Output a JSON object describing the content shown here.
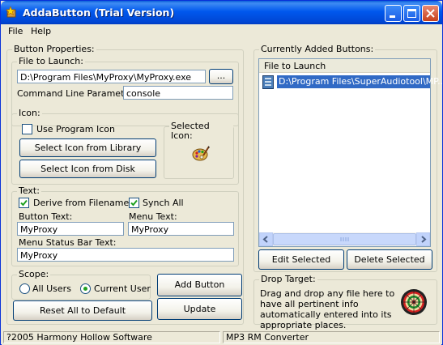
{
  "window": {
    "title": "AddaButton (Trial Version)"
  },
  "menu": {
    "file": "File",
    "help": "Help"
  },
  "button_properties": {
    "label": "Button Properties:",
    "file_to_launch": {
      "label": "File to Launch:",
      "value": "D:\\Program Files\\MyProxy\\MyProxy.exe",
      "browse": "..."
    },
    "command_line": {
      "label": "Command Line Parameters:",
      "value": "console"
    }
  },
  "icon": {
    "label": "Icon:",
    "use_program_icon": "Use Program Icon",
    "use_program_icon_checked": false,
    "selected_icon_label": "Selected Icon:",
    "select_library": "Select Icon from Library",
    "select_disk": "Select Icon from Disk"
  },
  "text": {
    "label": "Text:",
    "derive_from_filename": "Derive from Filename",
    "derive_checked": true,
    "synch_all": "Synch All",
    "synch_checked": true,
    "button_text_label": "Button Text:",
    "button_text_value": "MyProxy",
    "menu_text_label": "Menu Text:",
    "menu_text_value": "MyProxy",
    "status_bar_text_label": "Menu Status Bar Text:",
    "status_bar_text_value": "MyProxy"
  },
  "scope": {
    "label": "Scope:",
    "all_users": "All Users",
    "current_user": "Current User",
    "selected": "current_user"
  },
  "actions": {
    "add_button": "Add Button",
    "update": "Update",
    "reset": "Reset All to Default"
  },
  "current_buttons": {
    "label": "Currently Added Buttons:",
    "column": "File to Launch",
    "items": [
      "D:\\Program Files\\SuperAudiotool\\MP..."
    ],
    "edit": "Edit Selected",
    "delete": "Delete Selected"
  },
  "drop_target": {
    "label": "Drop Target:",
    "text": "Drag and drop any file here to have all pertinent info automatically entered into its appropriate places."
  },
  "status": {
    "left": "?2005 Harmony Hollow Software",
    "right": "MP3 RM Converter"
  },
  "colors": {
    "title_bar": "#0058ee",
    "selection": "#316ac5",
    "face": "#ece9d8"
  }
}
